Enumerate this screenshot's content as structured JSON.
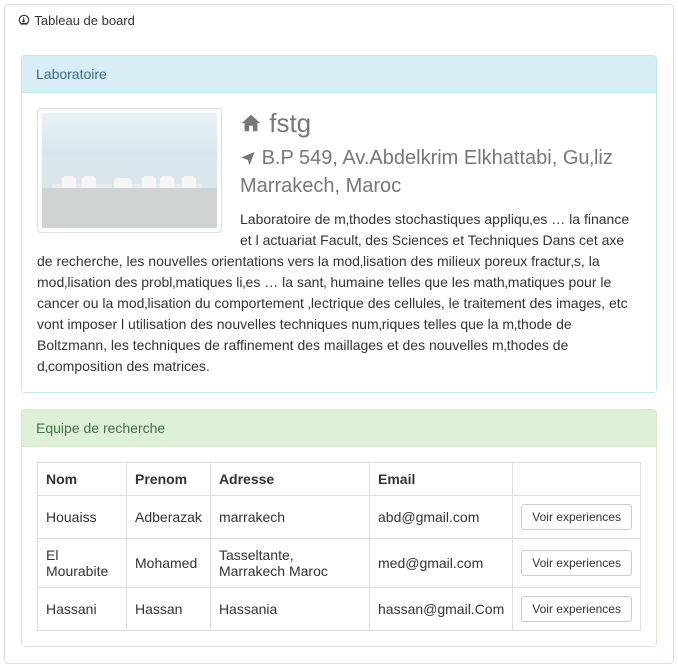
{
  "header": {
    "title": "Tableau de board"
  },
  "lab": {
    "panel_title": "Laboratoire",
    "name": "fstg",
    "address": "B.P 549, Av.Abdelkrim Elkhattabi, Gu‚liz Marrakech, Maroc",
    "description": "Laboratoire de m‚thodes stochastiques appliqu‚es … la finance et l actuariat Facult‚ des Sciences et Techniques Dans cet axe de recherche, les nouvelles orientations vers la mod‚lisation des milieux poreux fractur‚s, la mod‚lisation des probl‚matiques li‚es … la sant‚ humaine telles que les math‚matiques pour le cancer ou la mod‚lisation du comportement ‚lectrique des cellules, le traitement des images, etc vont imposer l utilisation des nouvelles techniques num‚riques telles que la m‚thode de Boltzmann, les techniques de raffinement des maillages et des nouvelles m‚thodes de d‚composition des matrices."
  },
  "team": {
    "panel_title": "Equipe de recherche",
    "columns": {
      "nom": "Nom",
      "prenom": "Prenom",
      "adresse": "Adresse",
      "email": "Email"
    },
    "action_label": "Voir experiences",
    "rows": [
      {
        "nom": "Houaiss",
        "prenom": "Adberazak",
        "adresse": "marrakech",
        "email": "abd@gmail.com"
      },
      {
        "nom": "El Mourabite",
        "prenom": "Mohamed",
        "adresse": "Tasseltante, Marrakech Maroc",
        "email": "med@gmail.com"
      },
      {
        "nom": "Hassani",
        "prenom": "Hassan",
        "adresse": "Hassania",
        "email": "hassan@gmail.Com"
      }
    ]
  }
}
